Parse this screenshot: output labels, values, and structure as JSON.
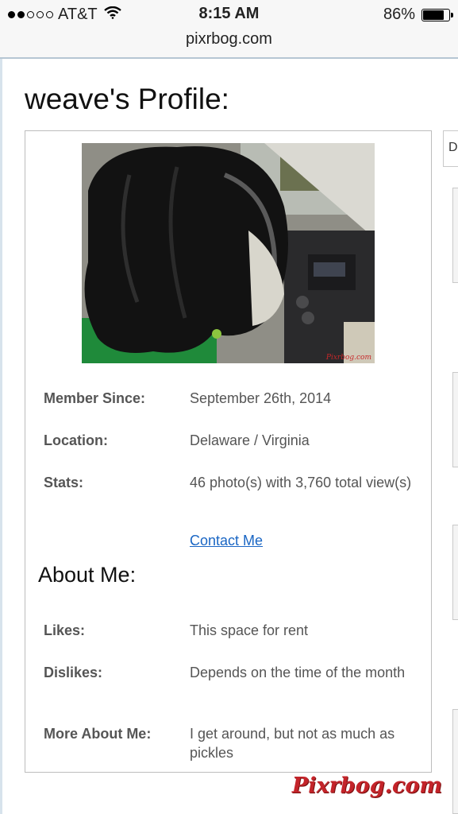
{
  "status_bar": {
    "carrier": "AT&T",
    "time": "8:15 AM",
    "battery": "86%",
    "battery_level": 0.86,
    "signal_bars": 2
  },
  "browser": {
    "url": "pixrbog.com"
  },
  "page": {
    "title": "weave's Profile:"
  },
  "profile": {
    "photo_watermark": "Pixrbog.com",
    "fields": {
      "member_since": {
        "label": "Member Since:",
        "value": "September 26th, 2014"
      },
      "location": {
        "label": "Location:",
        "value": "Delaware / Virginia"
      },
      "stats": {
        "label": "Stats:",
        "value": "46 photo(s) with 3,760 total view(s)"
      }
    },
    "contact_link": "Contact Me",
    "about_heading": "About Me:",
    "about": {
      "likes": {
        "label": "Likes:",
        "value": "This space for rent"
      },
      "dislikes": {
        "label": "Dislikes:",
        "value": "Depends on the time of the month"
      },
      "more": {
        "label": "More About Me:",
        "value": "I get around, but not as much as pickles"
      }
    }
  },
  "sidebar": {
    "tab_letter": "D"
  },
  "watermark": "Pixrbog.com"
}
